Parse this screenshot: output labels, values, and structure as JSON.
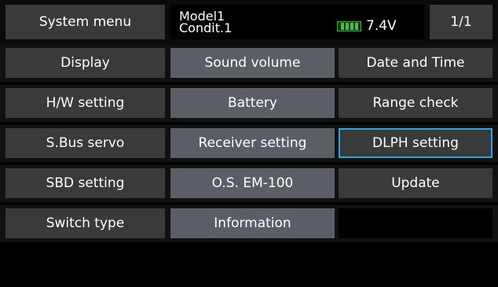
{
  "header": {
    "title": "System menu",
    "model_line1": "Model1",
    "model_line2": "Condit.1",
    "voltage": "7.4V",
    "battery_level": 1.0,
    "page": "1/1"
  },
  "menu": {
    "rows": [
      [
        "Display",
        "Sound volume",
        "Date and Time"
      ],
      [
        "H/W setting",
        "Battery",
        "Range check"
      ],
      [
        "S.Bus servo",
        "Receiver setting",
        "DLPH setting"
      ],
      [
        "SBD setting",
        "O.S. EM-100",
        "Update"
      ],
      [
        "Switch type",
        "Information",
        ""
      ]
    ],
    "selected": "DLPH setting"
  },
  "colors": {
    "button_dark": "#3a3a3a",
    "button_light": "#5a5f66",
    "selection_border": "#29a7e0",
    "battery_green": "#48c048"
  }
}
